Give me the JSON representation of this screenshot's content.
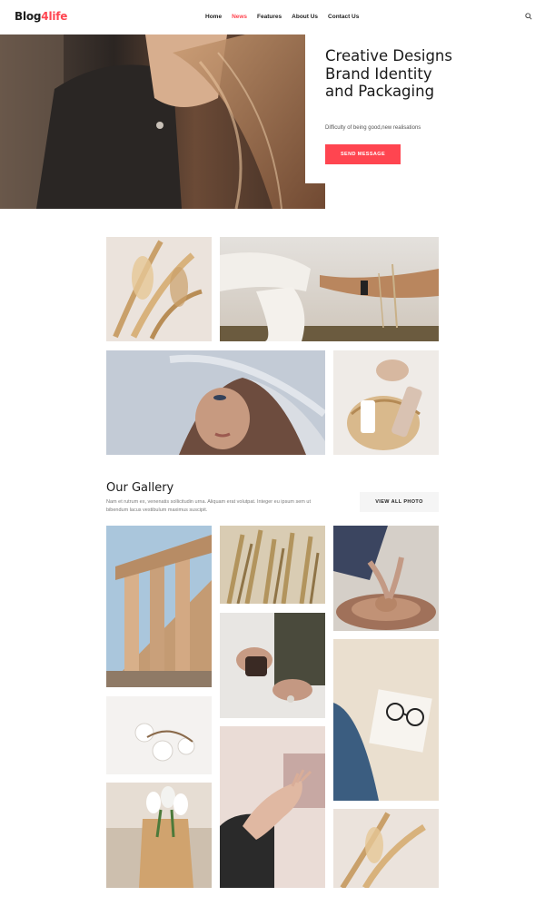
{
  "header": {
    "logo_part1": "Blog",
    "logo_part2": "4life",
    "nav": [
      "Home",
      "News",
      "Features",
      "About Us",
      "Contact Us"
    ],
    "active_nav": "News",
    "search_icon": "search-icon"
  },
  "hero": {
    "title": "Creative Designs Brand Identity and Packaging",
    "subtitle": "Difficulty of being good,new realisations",
    "button": "SEND MESSAGE"
  },
  "gallery": {
    "title": "Our Gallery",
    "description": "Nam et rutrum ex, venenatis sollicitudin urna. Aliquam erat volutpat. Integer eu ipsum sem ut bibendum lacus vestibulum maximus suscipit.",
    "button": "VIEW ALL PHOTO"
  },
  "colors": {
    "accent": "#ff4550",
    "text": "#1e1e1e",
    "muted": "#7a7a7a",
    "button_light": "#f5f5f5"
  }
}
